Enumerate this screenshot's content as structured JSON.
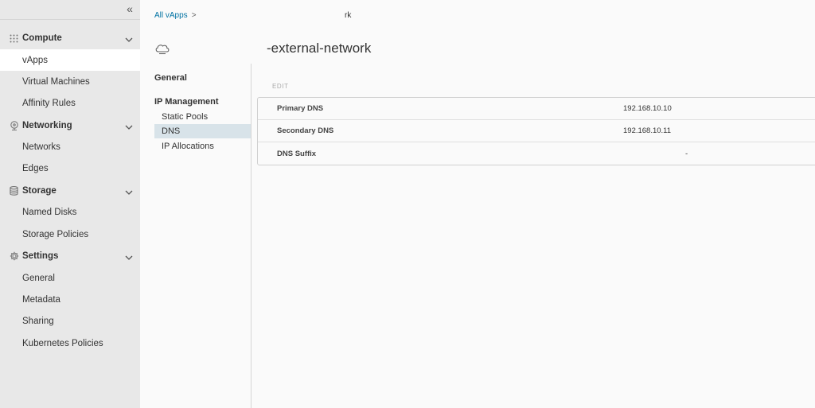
{
  "sidenav": {
    "collapse_glyph": "«",
    "groups": [
      {
        "label": "Compute",
        "icon": "grid-icon",
        "items": [
          {
            "label": "vApps",
            "active": true
          },
          {
            "label": "Virtual Machines"
          },
          {
            "label": "Affinity Rules"
          }
        ]
      },
      {
        "label": "Networking",
        "icon": "network-icon",
        "items": [
          {
            "label": "Networks"
          },
          {
            "label": "Edges"
          }
        ]
      },
      {
        "label": "Storage",
        "icon": "database-icon",
        "items": [
          {
            "label": "Named Disks"
          },
          {
            "label": "Storage Policies"
          }
        ]
      },
      {
        "label": "Settings",
        "icon": "gear-icon",
        "items": [
          {
            "label": "General"
          },
          {
            "label": "Metadata"
          },
          {
            "label": "Sharing"
          },
          {
            "label": "Kubernetes Policies"
          }
        ]
      }
    ]
  },
  "breadcrumb": {
    "link": "All vApps",
    "separator": ">",
    "current": "rk"
  },
  "header": {
    "icon": "cloud-icon",
    "title": "-external-network"
  },
  "tabnav": {
    "general": "General",
    "ip_management": "IP Management",
    "items": [
      {
        "label": "Static Pools"
      },
      {
        "label": "DNS",
        "active": true
      },
      {
        "label": "IP Allocations"
      }
    ]
  },
  "dns": {
    "edit_label": "EDIT",
    "rows": [
      {
        "label": "Primary DNS",
        "value": "192.168.10.10"
      },
      {
        "label": "Secondary DNS",
        "value": "192.168.10.11"
      },
      {
        "label": "DNS Suffix",
        "value": "-"
      }
    ]
  },
  "colors": {
    "link": "#0072a3",
    "nav_bg": "#e8e8e8",
    "active_tab_bg": "#d8e3e9"
  }
}
